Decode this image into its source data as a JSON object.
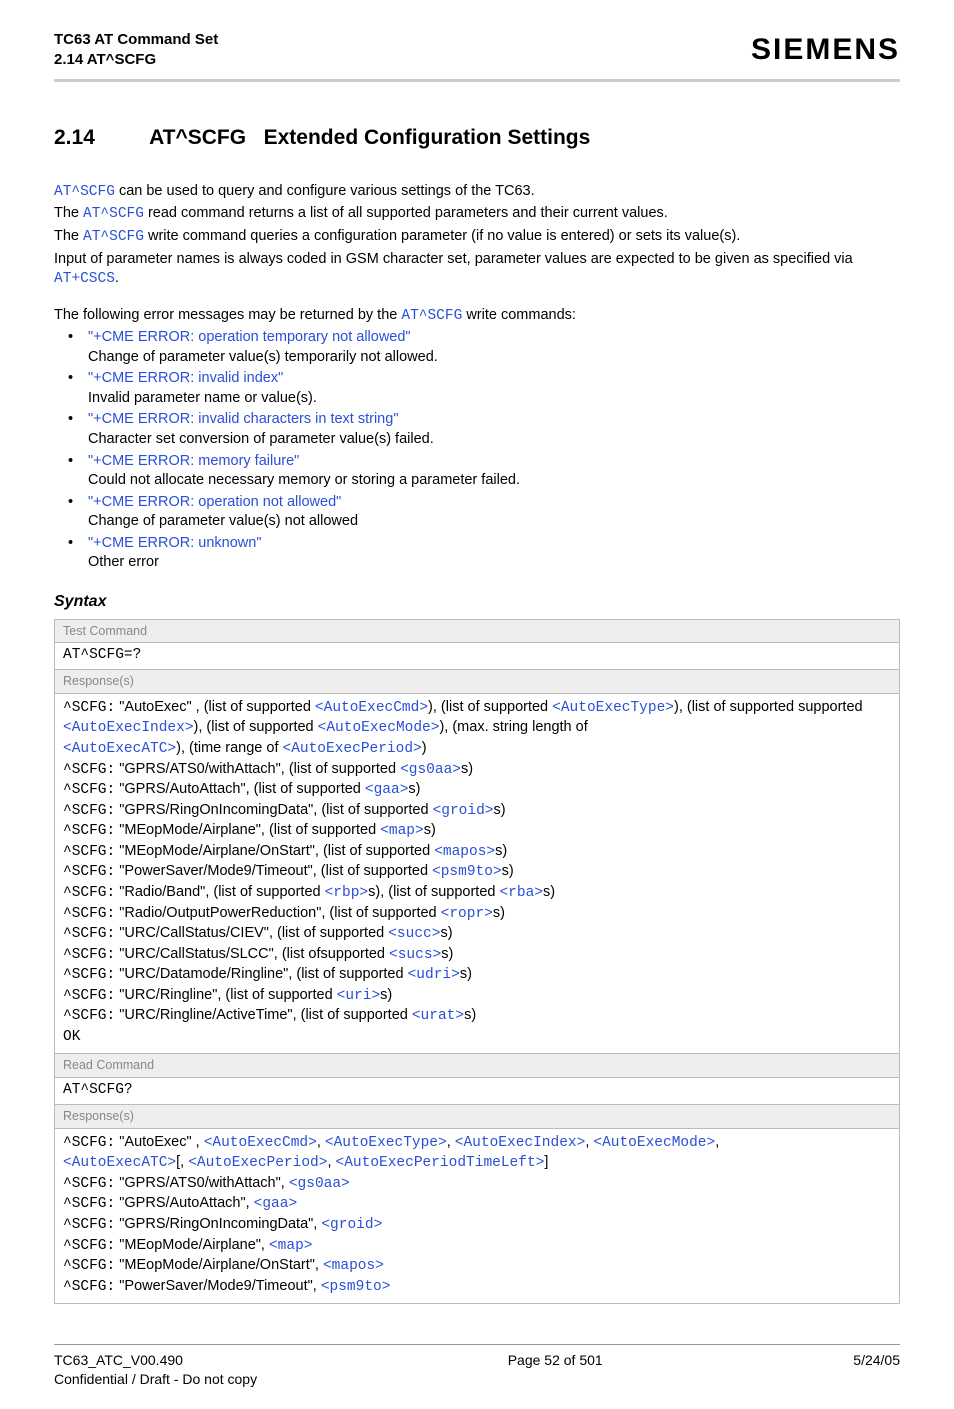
{
  "header": {
    "title": "TC63 AT Command Set",
    "subtitle": "2.14 AT^SCFG",
    "brand": "SIEMENS"
  },
  "section": {
    "number": "2.14",
    "cmd": "AT^SCFG",
    "title": "Extended Configuration Settings"
  },
  "intro": {
    "line1_cmd": "AT^SCFG",
    "line1_rest": " can be used to query and configure various settings of the TC63.",
    "line2_pre": "The ",
    "line2_cmd": "AT^SCFG",
    "line2_rest": " read command returns a list of all supported parameters and their current values.",
    "line3_pre": "The ",
    "line3_cmd": "AT^SCFG",
    "line3_rest": " write command queries a configuration parameter (if no value is entered) or sets its value(s).",
    "line4_pre": "Input of parameter names is always coded in GSM character set, parameter values are expected to be given as specified via ",
    "line4_cmd": "AT+CSCS",
    "line4_rest": ".",
    "errintro_pre": "The following error messages may be returned by the ",
    "errintro_cmd": "AT^SCFG",
    "errintro_rest": " write commands:"
  },
  "errors": [
    {
      "msg": "\"+CME ERROR: operation temporary not allowed\"",
      "desc": "Change of parameter value(s) temporarily not allowed."
    },
    {
      "msg": "\"+CME ERROR: invalid index\"",
      "desc": "Invalid parameter name or value(s)."
    },
    {
      "msg": "\"+CME ERROR: invalid characters in text string\"",
      "desc": "Character set conversion of parameter value(s) failed."
    },
    {
      "msg": "\"+CME ERROR: memory failure\"",
      "desc": "Could not allocate necessary memory or storing a parameter failed."
    },
    {
      "msg": "\"+CME ERROR: operation not allowed\"",
      "desc": "Change of parameter value(s) not allowed"
    },
    {
      "msg": "\"+CME ERROR: unknown\"",
      "desc": "Other error"
    }
  ],
  "syntax": {
    "heading": "Syntax",
    "test_label": "Test Command",
    "test_cmd": "AT^SCFG=?",
    "resp_label": "Response(s)",
    "test_resp": {
      "l1a": "^SCFG:",
      "l1b": " \"AutoExec\" , (list of supported ",
      "l1c": "<AutoExecCmd>",
      "l1d": "), (list of supported ",
      "l1e": "<AutoExecType>",
      "l1f": "), (list of supported ",
      "l2a": "<AutoExecIndex>",
      "l2b": "), (list of supported ",
      "l2c": "<AutoExecMode>",
      "l2d": "), (max. string length of ",
      "l3a": "<AutoExecATC>",
      "l3b": "), (time range of ",
      "l3c": "<AutoExecPeriod>",
      "l3d": ")",
      "rows": [
        {
          "p": "^SCFG:",
          "t": " \"GPRS/ATS0/withAttach\", (list of supported ",
          "v": "<gs0aa>",
          "s": "s)"
        },
        {
          "p": "^SCFG:",
          "t": " \"GPRS/AutoAttach\", (list of supported ",
          "v": "<gaa>",
          "s": "s)"
        },
        {
          "p": "^SCFG:",
          "t": " \"GPRS/RingOnIncomingData\", (list of supported ",
          "v": "<groid>",
          "s": "s)"
        },
        {
          "p": "^SCFG:",
          "t": " \"MEopMode/Airplane\", (list of supported ",
          "v": "<map>",
          "s": "s)"
        },
        {
          "p": "^SCFG:",
          "t": " \"MEopMode/Airplane/OnStart\", (list of supported ",
          "v": "<mapos>",
          "s": "s)"
        },
        {
          "p": "^SCFG:",
          "t": " \"PowerSaver/Mode9/Timeout\", (list of supported ",
          "v": "<psm9to>",
          "s": "s)"
        }
      ],
      "radio_p": "^SCFG:",
      "radio_t1": " \"Radio/Band\", (list of supported ",
      "radio_v1": "<rbp>",
      "radio_t2": "s), (list of supported ",
      "radio_v2": "<rba>",
      "radio_s": "s)",
      "rows2": [
        {
          "p": "^SCFG:",
          "t": " \"Radio/OutputPowerReduction\", (list of supported ",
          "v": "<ropr>",
          "s": "s)"
        },
        {
          "p": "^SCFG:",
          "t": " \"URC/CallStatus/CIEV\", (list of supported ",
          "v": "<succ>",
          "s": "s)"
        },
        {
          "p": "^SCFG:",
          "t": " \"URC/CallStatus/SLCC\", (list ofsupported ",
          "v": "<sucs>",
          "s": "s)"
        },
        {
          "p": "^SCFG:",
          "t": " \"URC/Datamode/Ringline\", (list of supported ",
          "v": "<udri>",
          "s": "s)"
        },
        {
          "p": "^SCFG:",
          "t": " \"URC/Ringline\", (list of supported ",
          "v": "<uri>",
          "s": "s)"
        },
        {
          "p": "^SCFG:",
          "t": " \"URC/Ringline/ActiveTime\", (list of supported ",
          "v": "<urat>",
          "s": "s)"
        }
      ],
      "ok": "OK"
    },
    "read_label": "Read Command",
    "read_cmd": "AT^SCFG?",
    "read_resp": {
      "l1a": "^SCFG:",
      "l1b": " \"AutoExec\" , ",
      "v1": "<AutoExecCmd>",
      "c": ", ",
      "v2": "<AutoExecType>",
      "v3": "<AutoExecIndex>",
      "v4": "<AutoExecMode>",
      "v5": "<AutoExecATC>",
      "lb": "[, ",
      "v6": "<AutoExecPeriod>",
      "v7": "<AutoExecPeriodTimeLeft>",
      "rb": "]",
      "rows": [
        {
          "p": "^SCFG:",
          "t": " \"GPRS/ATS0/withAttach\", ",
          "v": "<gs0aa>"
        },
        {
          "p": "^SCFG:",
          "t": " \"GPRS/AutoAttach\", ",
          "v": "<gaa>"
        },
        {
          "p": "^SCFG:",
          "t": " \"GPRS/RingOnIncomingData\", ",
          "v": "<groid>"
        },
        {
          "p": "^SCFG:",
          "t": " \"MEopMode/Airplane\", ",
          "v": "<map>"
        },
        {
          "p": "^SCFG:",
          "t": " \"MEopMode/Airplane/OnStart\", ",
          "v": "<mapos>"
        },
        {
          "p": "^SCFG:",
          "t": " \"PowerSaver/Mode9/Timeout\", ",
          "v": "<psm9to>"
        }
      ]
    }
  },
  "footer": {
    "left1": "TC63_ATC_V00.490",
    "left2": "Confidential / Draft - Do not copy",
    "center": "Page 52 of 501",
    "right": "5/24/05"
  }
}
